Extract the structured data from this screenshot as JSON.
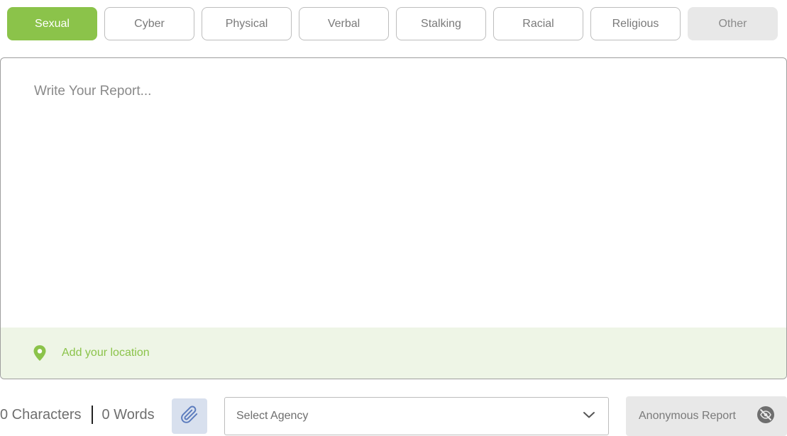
{
  "categories": [
    {
      "label": "Sexual",
      "state": "active"
    },
    {
      "label": "Cyber",
      "state": "default"
    },
    {
      "label": "Physical",
      "state": "default"
    },
    {
      "label": "Verbal",
      "state": "default"
    },
    {
      "label": "Stalking",
      "state": "default"
    },
    {
      "label": "Racial",
      "state": "default"
    },
    {
      "label": "Religious",
      "state": "default"
    },
    {
      "label": "Other",
      "state": "muted"
    }
  ],
  "report": {
    "placeholder": "Write Your Report...",
    "value": ""
  },
  "location": {
    "label": "Add your location",
    "icon": "map-pin-icon"
  },
  "counts": {
    "characters": "0 Characters",
    "words": "0 Words"
  },
  "attach": {
    "icon": "paperclip-icon"
  },
  "agency": {
    "placeholder": "Select Agency",
    "icon": "chevron-down-icon"
  },
  "anonymous": {
    "label": "Anonymous Report",
    "icon": "eye-off-icon"
  },
  "colors": {
    "accent": "#8bc34a",
    "location_bg": "#eef5e6",
    "muted_bg": "#e8e8e8",
    "attach_bg": "#d8e0ee"
  }
}
